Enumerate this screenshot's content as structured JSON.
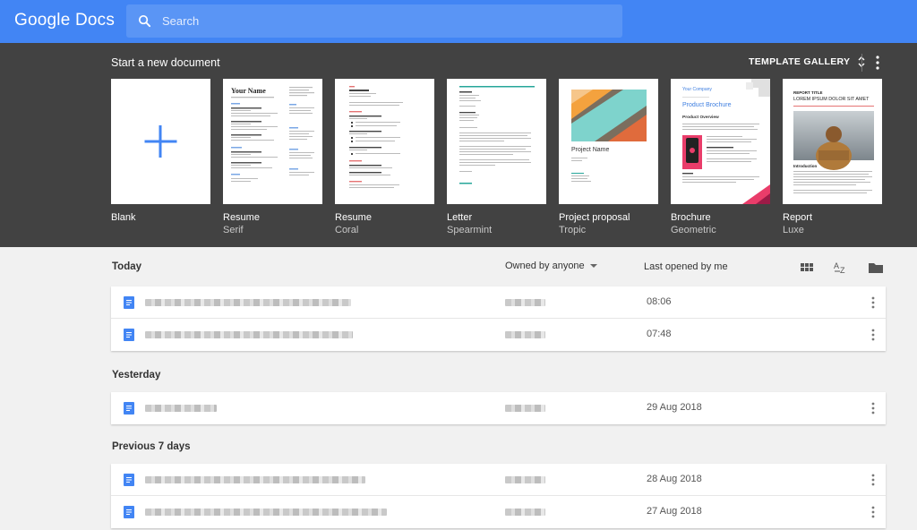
{
  "app": {
    "logo_text": "Google Docs"
  },
  "search": {
    "placeholder": "Search"
  },
  "templates": {
    "title": "Start a new document",
    "gallery_label": "TEMPLATE GALLERY",
    "items": [
      {
        "name": "Blank",
        "sub": ""
      },
      {
        "name": "Resume",
        "sub": "Serif"
      },
      {
        "name": "Resume",
        "sub": "Coral"
      },
      {
        "name": "Letter",
        "sub": "Spearmint"
      },
      {
        "name": "Project proposal",
        "sub": "Tropic"
      },
      {
        "name": "Brochure",
        "sub": "Geometric"
      },
      {
        "name": "Report",
        "sub": "Luxe"
      }
    ],
    "thumb_text": {
      "your_name": "Your Name",
      "project_name": "Project Name",
      "your_company": "Your Company",
      "product_brochure": "Product Brochure",
      "product_overview": "Product Overview",
      "report_title": "REPORT TITLE",
      "lorem": "LOREM IPSUM DOLOR SIT AMET",
      "introduction": "Introduction"
    }
  },
  "list": {
    "owner_filter": "Owned by anyone",
    "sort_label": "Last opened by me",
    "sections": [
      {
        "label": "Today",
        "rows": [
          {
            "time": "08:06"
          },
          {
            "time": "07:48"
          }
        ]
      },
      {
        "label": "Yesterday",
        "rows": [
          {
            "time": "29 Aug 2018"
          }
        ]
      },
      {
        "label": "Previous 7 days",
        "rows": [
          {
            "time": "28 Aug 2018"
          },
          {
            "time": "27 Aug 2018"
          }
        ]
      }
    ]
  },
  "colors": {
    "brand": "#4285f4",
    "template_bg": "#424242",
    "doc_icon": "#4285f4"
  }
}
